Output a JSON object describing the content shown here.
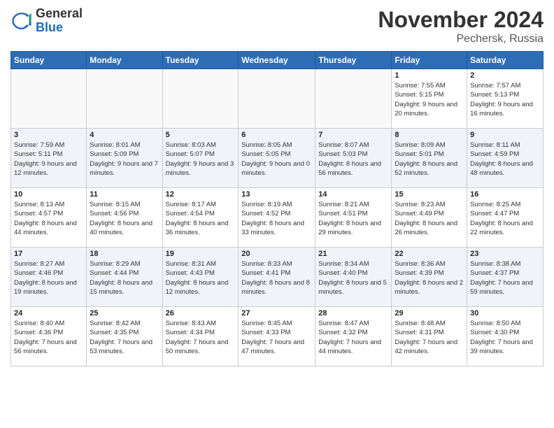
{
  "header": {
    "logo": {
      "general": "General",
      "blue": "Blue"
    },
    "title": "November 2024",
    "location": "Pechersk, Russia"
  },
  "weekdays": [
    "Sunday",
    "Monday",
    "Tuesday",
    "Wednesday",
    "Thursday",
    "Friday",
    "Saturday"
  ],
  "weeks": [
    [
      {
        "day": "",
        "info": ""
      },
      {
        "day": "",
        "info": ""
      },
      {
        "day": "",
        "info": ""
      },
      {
        "day": "",
        "info": ""
      },
      {
        "day": "",
        "info": ""
      },
      {
        "day": "1",
        "info": "Sunrise: 7:55 AM\nSunset: 5:15 PM\nDaylight: 9 hours and 20 minutes."
      },
      {
        "day": "2",
        "info": "Sunrise: 7:57 AM\nSunset: 5:13 PM\nDaylight: 9 hours and 16 minutes."
      }
    ],
    [
      {
        "day": "3",
        "info": "Sunrise: 7:59 AM\nSunset: 5:11 PM\nDaylight: 9 hours and 12 minutes."
      },
      {
        "day": "4",
        "info": "Sunrise: 8:01 AM\nSunset: 5:09 PM\nDaylight: 9 hours and 7 minutes."
      },
      {
        "day": "5",
        "info": "Sunrise: 8:03 AM\nSunset: 5:07 PM\nDaylight: 9 hours and 3 minutes."
      },
      {
        "day": "6",
        "info": "Sunrise: 8:05 AM\nSunset: 5:05 PM\nDaylight: 9 hours and 0 minutes."
      },
      {
        "day": "7",
        "info": "Sunrise: 8:07 AM\nSunset: 5:03 PM\nDaylight: 8 hours and 56 minutes."
      },
      {
        "day": "8",
        "info": "Sunrise: 8:09 AM\nSunset: 5:01 PM\nDaylight: 8 hours and 52 minutes."
      },
      {
        "day": "9",
        "info": "Sunrise: 8:11 AM\nSunset: 4:59 PM\nDaylight: 8 hours and 48 minutes."
      }
    ],
    [
      {
        "day": "10",
        "info": "Sunrise: 8:13 AM\nSunset: 4:57 PM\nDaylight: 8 hours and 44 minutes."
      },
      {
        "day": "11",
        "info": "Sunrise: 8:15 AM\nSunset: 4:56 PM\nDaylight: 8 hours and 40 minutes."
      },
      {
        "day": "12",
        "info": "Sunrise: 8:17 AM\nSunset: 4:54 PM\nDaylight: 8 hours and 36 minutes."
      },
      {
        "day": "13",
        "info": "Sunrise: 8:19 AM\nSunset: 4:52 PM\nDaylight: 8 hours and 33 minutes."
      },
      {
        "day": "14",
        "info": "Sunrise: 8:21 AM\nSunset: 4:51 PM\nDaylight: 8 hours and 29 minutes."
      },
      {
        "day": "15",
        "info": "Sunrise: 8:23 AM\nSunset: 4:49 PM\nDaylight: 8 hours and 26 minutes."
      },
      {
        "day": "16",
        "info": "Sunrise: 8:25 AM\nSunset: 4:47 PM\nDaylight: 8 hours and 22 minutes."
      }
    ],
    [
      {
        "day": "17",
        "info": "Sunrise: 8:27 AM\nSunset: 4:46 PM\nDaylight: 8 hours and 19 minutes."
      },
      {
        "day": "18",
        "info": "Sunrise: 8:29 AM\nSunset: 4:44 PM\nDaylight: 8 hours and 15 minutes."
      },
      {
        "day": "19",
        "info": "Sunrise: 8:31 AM\nSunset: 4:43 PM\nDaylight: 8 hours and 12 minutes."
      },
      {
        "day": "20",
        "info": "Sunrise: 8:33 AM\nSunset: 4:41 PM\nDaylight: 8 hours and 8 minutes."
      },
      {
        "day": "21",
        "info": "Sunrise: 8:34 AM\nSunset: 4:40 PM\nDaylight: 8 hours and 5 minutes."
      },
      {
        "day": "22",
        "info": "Sunrise: 8:36 AM\nSunset: 4:39 PM\nDaylight: 8 hours and 2 minutes."
      },
      {
        "day": "23",
        "info": "Sunrise: 8:38 AM\nSunset: 4:37 PM\nDaylight: 7 hours and 59 minutes."
      }
    ],
    [
      {
        "day": "24",
        "info": "Sunrise: 8:40 AM\nSunset: 4:36 PM\nDaylight: 7 hours and 56 minutes."
      },
      {
        "day": "25",
        "info": "Sunrise: 8:42 AM\nSunset: 4:35 PM\nDaylight: 7 hours and 53 minutes."
      },
      {
        "day": "26",
        "info": "Sunrise: 8:43 AM\nSunset: 4:34 PM\nDaylight: 7 hours and 50 minutes."
      },
      {
        "day": "27",
        "info": "Sunrise: 8:45 AM\nSunset: 4:33 PM\nDaylight: 7 hours and 47 minutes."
      },
      {
        "day": "28",
        "info": "Sunrise: 8:47 AM\nSunset: 4:32 PM\nDaylight: 7 hours and 44 minutes."
      },
      {
        "day": "29",
        "info": "Sunrise: 8:48 AM\nSunset: 4:31 PM\nDaylight: 7 hours and 42 minutes."
      },
      {
        "day": "30",
        "info": "Sunrise: 8:50 AM\nSunset: 4:30 PM\nDaylight: 7 hours and 39 minutes."
      }
    ]
  ]
}
